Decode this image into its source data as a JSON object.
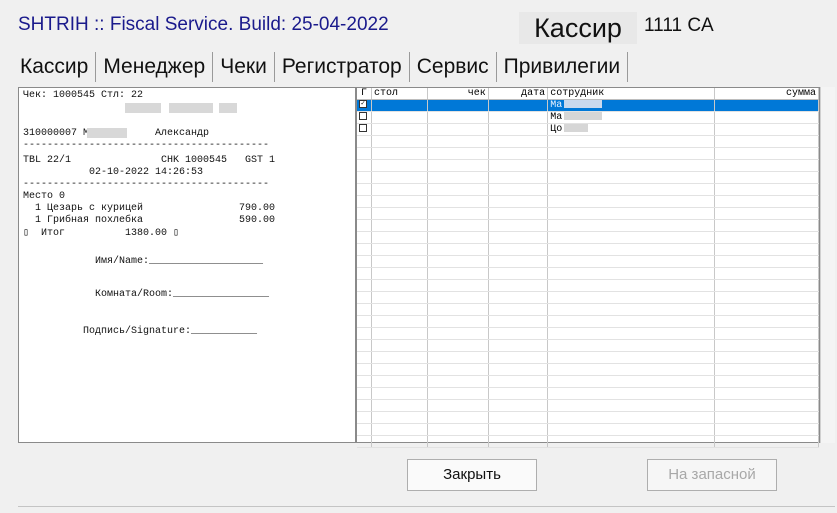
{
  "header": {
    "app_title": "SHTRIH :: Fiscal Service. Build: 25-04-2022",
    "role": "Кассир",
    "user_code": "1111 CA"
  },
  "tabs": [
    {
      "label": "Кассир"
    },
    {
      "label": "Менеджер"
    },
    {
      "label": "Чеки"
    },
    {
      "label": "Регистратор"
    },
    {
      "label": "Сервис"
    },
    {
      "label": "Привилегии"
    }
  ],
  "receipt": {
    "header": "Чек: 1000545 Стл: 22",
    "customer": "310000007 Ма          Александр",
    "separator": "-----------------------------------------",
    "table_line": "TBL 22/1               CHK 1000545   GST 1",
    "datetime": "           02-10-2022 14:26:53",
    "place": "Место 0",
    "item1": "  1 Цезарь с курицей                790.00",
    "item2": "  1 Грибная похлебка                590.00",
    "total": "▯  Итог          1380.00 ▯",
    "name_line": "            Имя/Name:___________________",
    "room_line": "            Комната/Room:________________",
    "sign_line": "          Подпись/Signature:___________"
  },
  "grid": {
    "columns": [
      "Γ",
      "стол",
      "чек",
      "дата",
      "сотрудник",
      "сумма"
    ],
    "rows": [
      {
        "checked": true,
        "employee": "Ма",
        "selected": true
      },
      {
        "checked": false,
        "employee": "Ма",
        "selected": false
      },
      {
        "checked": false,
        "employee": "Цо",
        "selected": false
      }
    ]
  },
  "buttons": {
    "close": "Закрыть",
    "backup": "На запасной"
  },
  "colors": {
    "selection": "#0078d7",
    "title_blue": "#1a1a8c"
  }
}
